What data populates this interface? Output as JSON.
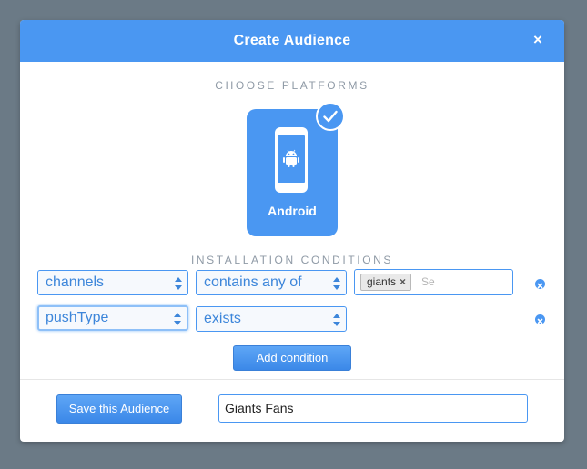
{
  "modal": {
    "title": "Create Audience",
    "close_label": "×"
  },
  "platforms": {
    "section_label": "CHOOSE PLATFORMS",
    "items": [
      {
        "label": "Android",
        "selected": true,
        "icon": "android-phone-icon"
      }
    ]
  },
  "conditions": {
    "section_label": "INSTALLATION CONDITIONS",
    "rows": [
      {
        "field": "channels",
        "operator": "contains any of",
        "tags": [
          "giants"
        ],
        "tag_remove": "×",
        "value_placeholder": "Se"
      },
      {
        "field": "pushType",
        "operator": "exists"
      }
    ],
    "add_label": "Add condition"
  },
  "footer": {
    "save_label": "Save this Audience",
    "audience_name": "Giants Fans"
  },
  "colors": {
    "backdrop": "#6b7a86",
    "accent": "#4a97f2",
    "section_label": "#8f9aa6"
  }
}
